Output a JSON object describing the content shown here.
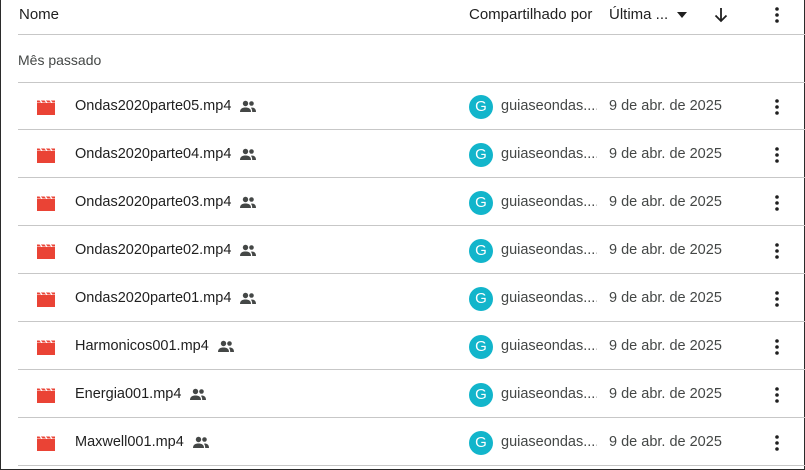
{
  "header": {
    "name_label": "Nome",
    "shared_label": "Compartilhado por",
    "modified_label": "Última ..."
  },
  "group_label": "Mês passado",
  "colors": {
    "video_icon": "#ea4335",
    "avatar_bg": "#12b5cb",
    "divider": "#c7c7c7"
  },
  "icons": {
    "file": "video-file-icon",
    "shared": "shared-people-icon",
    "more": "more-vert-icon",
    "sort": "arrow-down-icon",
    "caret": "caret-down-icon"
  },
  "files": [
    {
      "name": "Ondas2020parte05.mp4",
      "avatar": "G",
      "owner": "guiaseondas....",
      "date": "9 de abr. de 2025"
    },
    {
      "name": "Ondas2020parte04.mp4",
      "avatar": "G",
      "owner": "guiaseondas....",
      "date": "9 de abr. de 2025"
    },
    {
      "name": "Ondas2020parte03.mp4",
      "avatar": "G",
      "owner": "guiaseondas....",
      "date": "9 de abr. de 2025"
    },
    {
      "name": "Ondas2020parte02.mp4",
      "avatar": "G",
      "owner": "guiaseondas....",
      "date": "9 de abr. de 2025"
    },
    {
      "name": "Ondas2020parte01.mp4",
      "avatar": "G",
      "owner": "guiaseondas....",
      "date": "9 de abr. de 2025"
    },
    {
      "name": "Harmonicos001.mp4",
      "avatar": "G",
      "owner": "guiaseondas....",
      "date": "9 de abr. de 2025"
    },
    {
      "name": "Energia001.mp4",
      "avatar": "G",
      "owner": "guiaseondas....",
      "date": "9 de abr. de 2025"
    },
    {
      "name": "Maxwell001.mp4",
      "avatar": "G",
      "owner": "guiaseondas....",
      "date": "9 de abr. de 2025"
    }
  ]
}
